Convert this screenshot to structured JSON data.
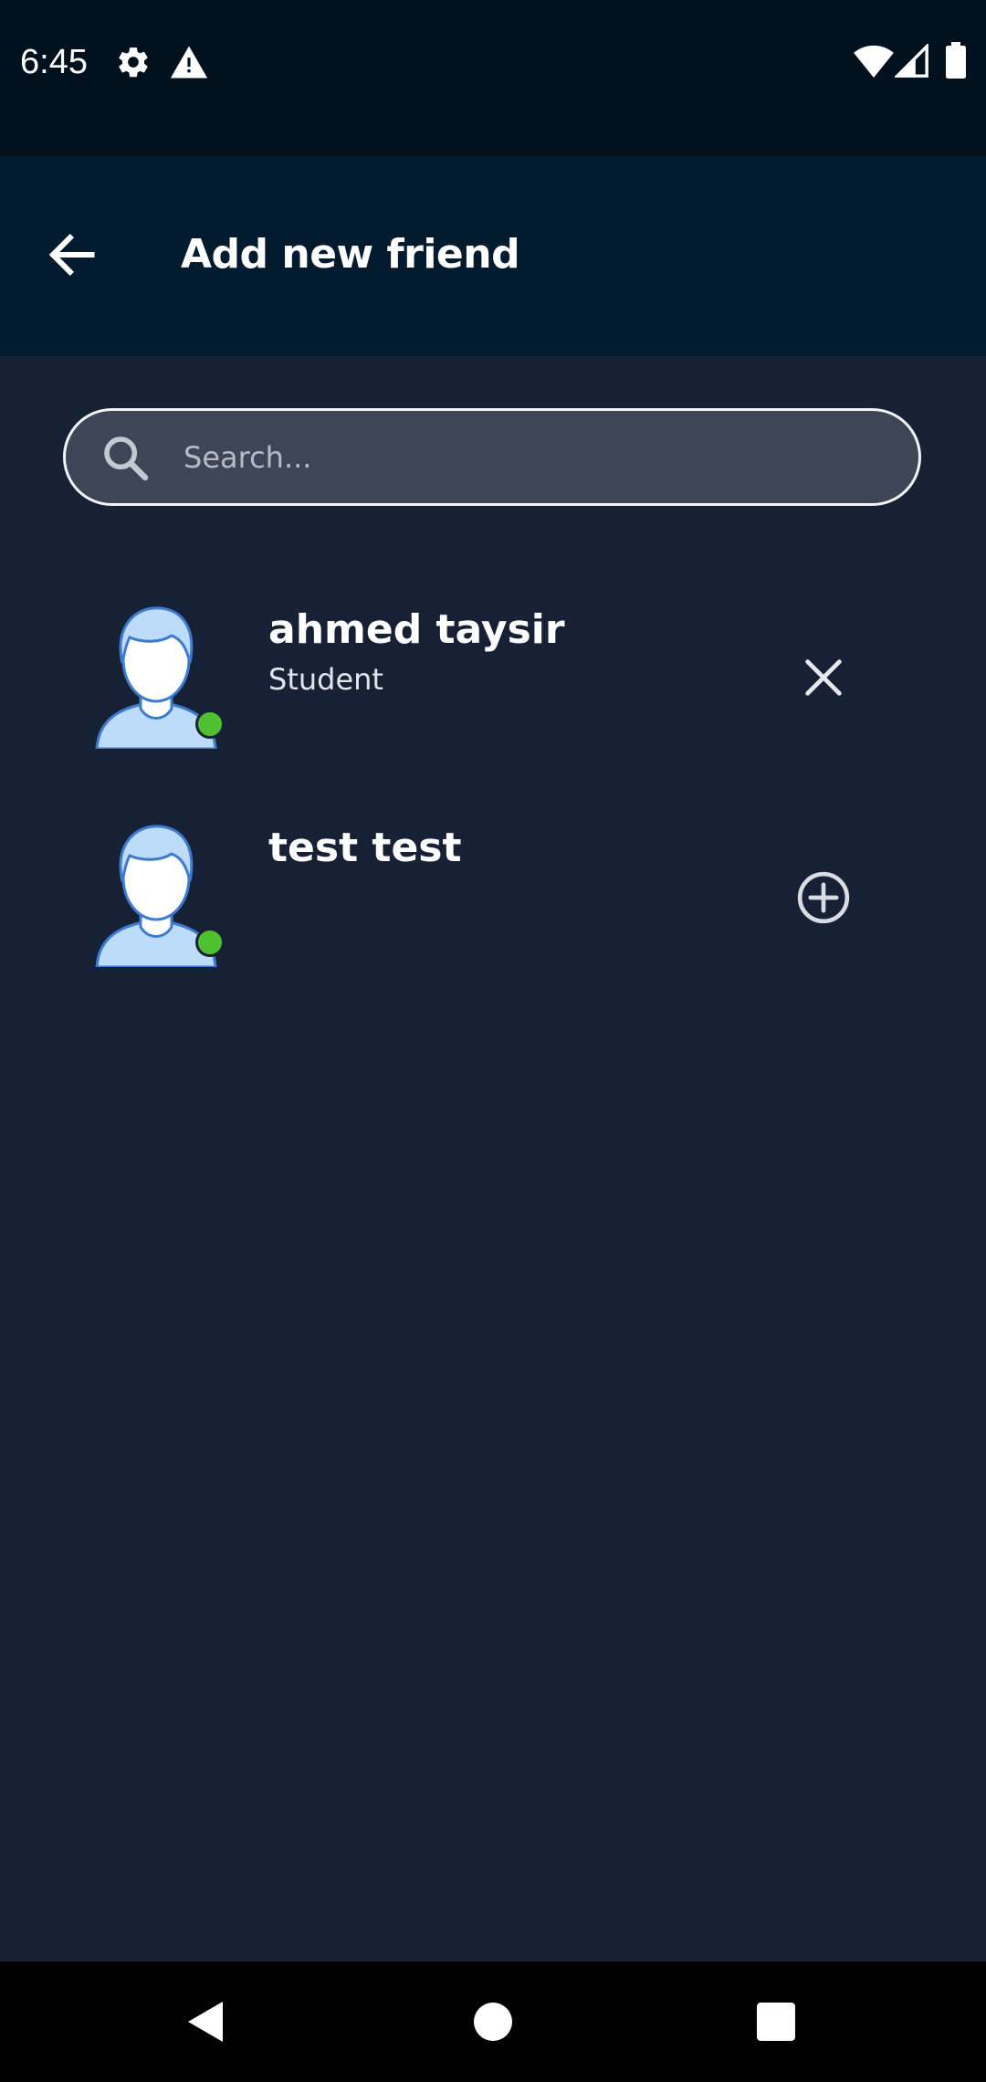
{
  "status_bar": {
    "time": "6:45",
    "left_icons": [
      "gear-icon",
      "alert-triangle-icon"
    ],
    "right_icons": [
      "wifi-icon",
      "signal-icon",
      "battery-icon"
    ]
  },
  "header": {
    "title": "Add new friend",
    "back_icon": "arrow-left-icon"
  },
  "search": {
    "placeholder": "Search...",
    "value": ""
  },
  "users": [
    {
      "name": "ahmed taysir",
      "role": "Student",
      "online": true,
      "action_icon": "close-icon"
    },
    {
      "name": "test test",
      "role": "",
      "online": true,
      "action_icon": "add-circle-icon"
    }
  ],
  "nav": {
    "icons": [
      "back-triangle-icon",
      "home-circle-icon",
      "recents-square-icon"
    ]
  },
  "colors": {
    "background": "#172135",
    "status_bar": "#02111e",
    "app_bar": "#021b2e",
    "search_fill": "#3e4557",
    "online": "#4fc130",
    "avatar_fill": "#bcdcfa",
    "avatar_stroke": "#3d7bd0"
  }
}
